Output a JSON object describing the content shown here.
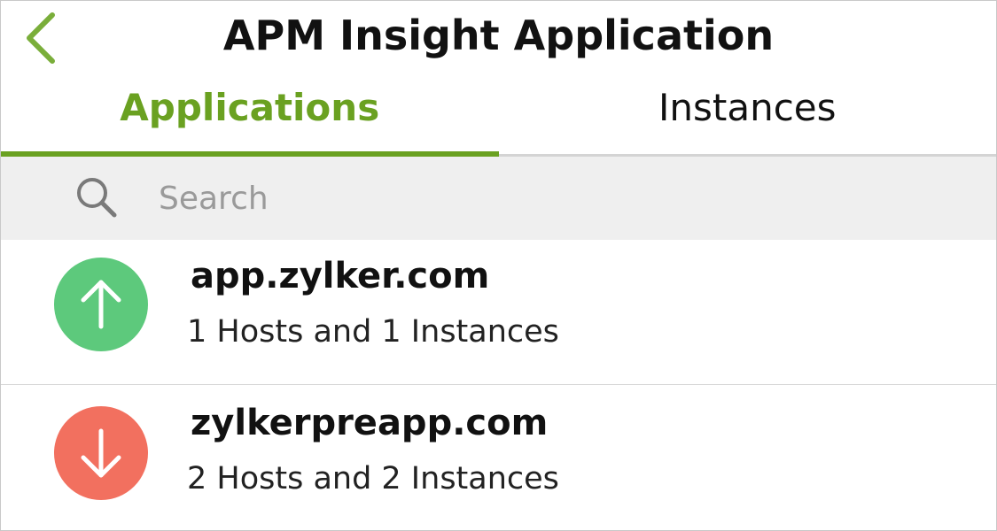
{
  "header": {
    "title": "APM Insight Application",
    "back_icon": "chevron-left-icon"
  },
  "tabs": [
    {
      "label": "Applications",
      "active": true
    },
    {
      "label": "Instances",
      "active": false
    }
  ],
  "search": {
    "placeholder": "Search",
    "value": ""
  },
  "applications": [
    {
      "name": "app.zylker.com",
      "summary": "1 Hosts and 1 Instances",
      "status": "up",
      "status_icon": "arrow-up-icon",
      "status_color": "#5dc97c"
    },
    {
      "name": "zylkerpreapp.com",
      "summary": "2 Hosts and 2 Instances",
      "status": "down",
      "status_icon": "arrow-down-icon",
      "status_color": "#f2705f"
    }
  ],
  "colors": {
    "accent": "#6aa121",
    "search_bg": "#efefef"
  }
}
